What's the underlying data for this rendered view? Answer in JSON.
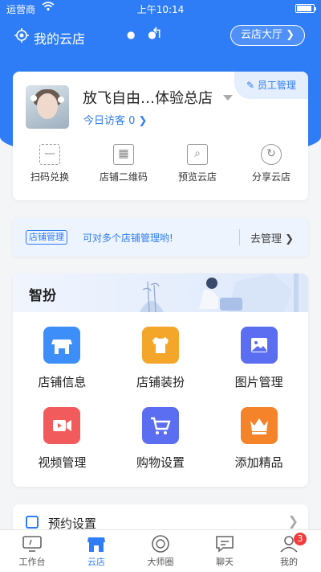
{
  "status_bar": {
    "carrier": "运营商",
    "time": "上午10:14"
  },
  "header": {
    "title": "我的云店",
    "hall_button": "云店大厅 ❯"
  },
  "store": {
    "name": "放飞自由…体验总店",
    "visitors": "今日访客 0 ❯",
    "staff_button": "员工管理",
    "actions": [
      {
        "label": "扫码兑换",
        "icon": "scan-icon"
      },
      {
        "label": "店铺二维码",
        "icon": "qrcode-icon"
      },
      {
        "label": "预览云店",
        "icon": "preview-icon"
      },
      {
        "label": "分享云店",
        "icon": "share-icon"
      }
    ]
  },
  "manage": {
    "tag": "店铺管理",
    "tip": "可对多个店铺管理哟!",
    "go": "去管理 ❯"
  },
  "zhiban": {
    "title": "智扮",
    "items": [
      {
        "label": "店铺信息",
        "icon": "store-info-icon",
        "color": "#3d8ef8"
      },
      {
        "label": "店铺装扮",
        "icon": "tshirt-icon",
        "color": "#f4a62a"
      },
      {
        "label": "图片管理",
        "icon": "picture-icon",
        "color": "#5b6ef2"
      },
      {
        "label": "视频管理",
        "icon": "video-icon",
        "color": "#f25b5b"
      },
      {
        "label": "购物设置",
        "icon": "cart-icon",
        "color": "#5b6ef2"
      },
      {
        "label": "添加精品",
        "icon": "crown-icon",
        "color": "#f4832a"
      }
    ]
  },
  "appointment": {
    "label": "预约设置"
  },
  "tabbar": {
    "tabs": [
      {
        "label": "工作台"
      },
      {
        "label": "云店"
      },
      {
        "label": "大师圈"
      },
      {
        "label": "聊天"
      },
      {
        "label": "我的",
        "badge": "3"
      }
    ],
    "active_color": "#2f7df6"
  },
  "colors": {
    "brand": "#2f7df6",
    "badge": "#f23c3c"
  }
}
